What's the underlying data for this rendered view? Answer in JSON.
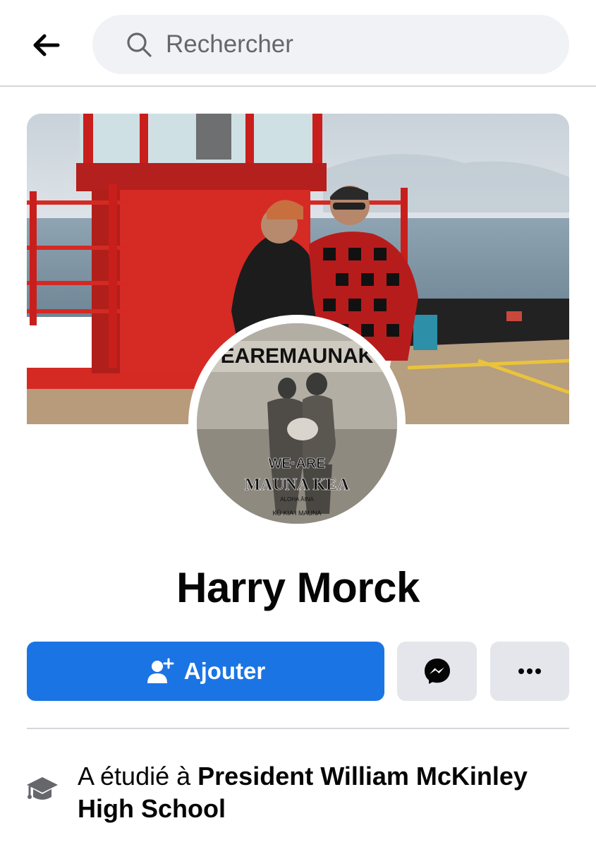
{
  "header": {
    "back_icon": "arrow-left-icon",
    "search": {
      "placeholder": "Rechercher",
      "icon": "search-icon"
    }
  },
  "cover_photo": {
    "description_icon": "cover-photo"
  },
  "avatar": {
    "top_text": "EAREMAUNAK",
    "we_are": "WE·ARE",
    "mauna_kea": "MAUNA KEA",
    "aloha": "ALOHA ĀINA",
    "ko_kiai": "KŪ KIAʻI MAUNA"
  },
  "profile": {
    "name": "Harry Morck"
  },
  "actions": {
    "add_label": "Ajouter",
    "add_icon": "add-friend-icon",
    "message_icon": "messenger-icon",
    "more_icon": "more-dots-icon",
    "accent": "#1b74e4"
  },
  "intro": {
    "education_icon": "graduation-cap-icon",
    "education_prefix": "A étudié à ",
    "education_school": "President William McKinley High School"
  }
}
